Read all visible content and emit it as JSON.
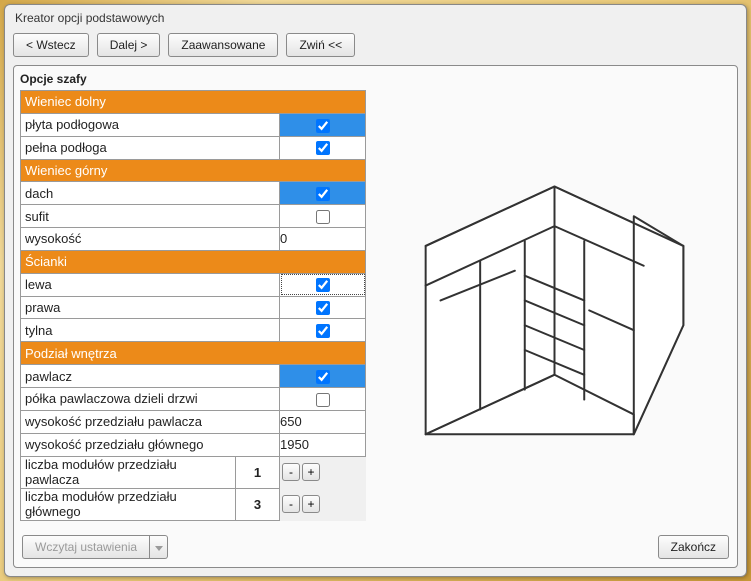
{
  "window": {
    "title": "Kreator opcji podstawowych"
  },
  "toolbar": {
    "back": "< Wstecz",
    "next": "Dalej >",
    "advanced": "Zaawansowane",
    "collapse": "Zwiń <<"
  },
  "section": "Opcje szafy",
  "groups": {
    "wieniec_dolny": {
      "title": "Wieniec dolny",
      "rows": [
        {
          "label": "płyta podłogowa",
          "checked": true,
          "selected": true
        },
        {
          "label": "pełna podłoga",
          "checked": true
        }
      ]
    },
    "wieniec_gorny": {
      "title": "Wieniec górny",
      "rows": [
        {
          "label": "dach",
          "checked": true,
          "selected": true
        },
        {
          "label": "sufit",
          "checked": false
        },
        {
          "label": "wysokość",
          "value": "0"
        }
      ]
    },
    "scianki": {
      "title": "Ścianki",
      "rows": [
        {
          "label": "lewa",
          "checked": true,
          "dotted": true
        },
        {
          "label": "prawa",
          "checked": true
        },
        {
          "label": "tylna",
          "checked": true
        }
      ]
    },
    "podzial": {
      "title": "Podział wnętrza",
      "rows": [
        {
          "label": "pawlacz",
          "checked": true,
          "selected": true
        },
        {
          "label": "półka pawlaczowa dzieli drzwi",
          "checked": false
        },
        {
          "label": "wysokość przedziału pawlacza",
          "value": "650"
        },
        {
          "label": "wysokość przedziału głównego",
          "value": "1950"
        }
      ],
      "spinners": [
        {
          "label": "liczba modułów przedziału pawlacza",
          "value": "1"
        },
        {
          "label": "liczba modułów przedziału głównego",
          "value": "3"
        }
      ]
    }
  },
  "spin": {
    "minus": "-",
    "plus": "+"
  },
  "footer": {
    "load": "Wczytaj ustawienia",
    "finish": "Zakończ"
  }
}
